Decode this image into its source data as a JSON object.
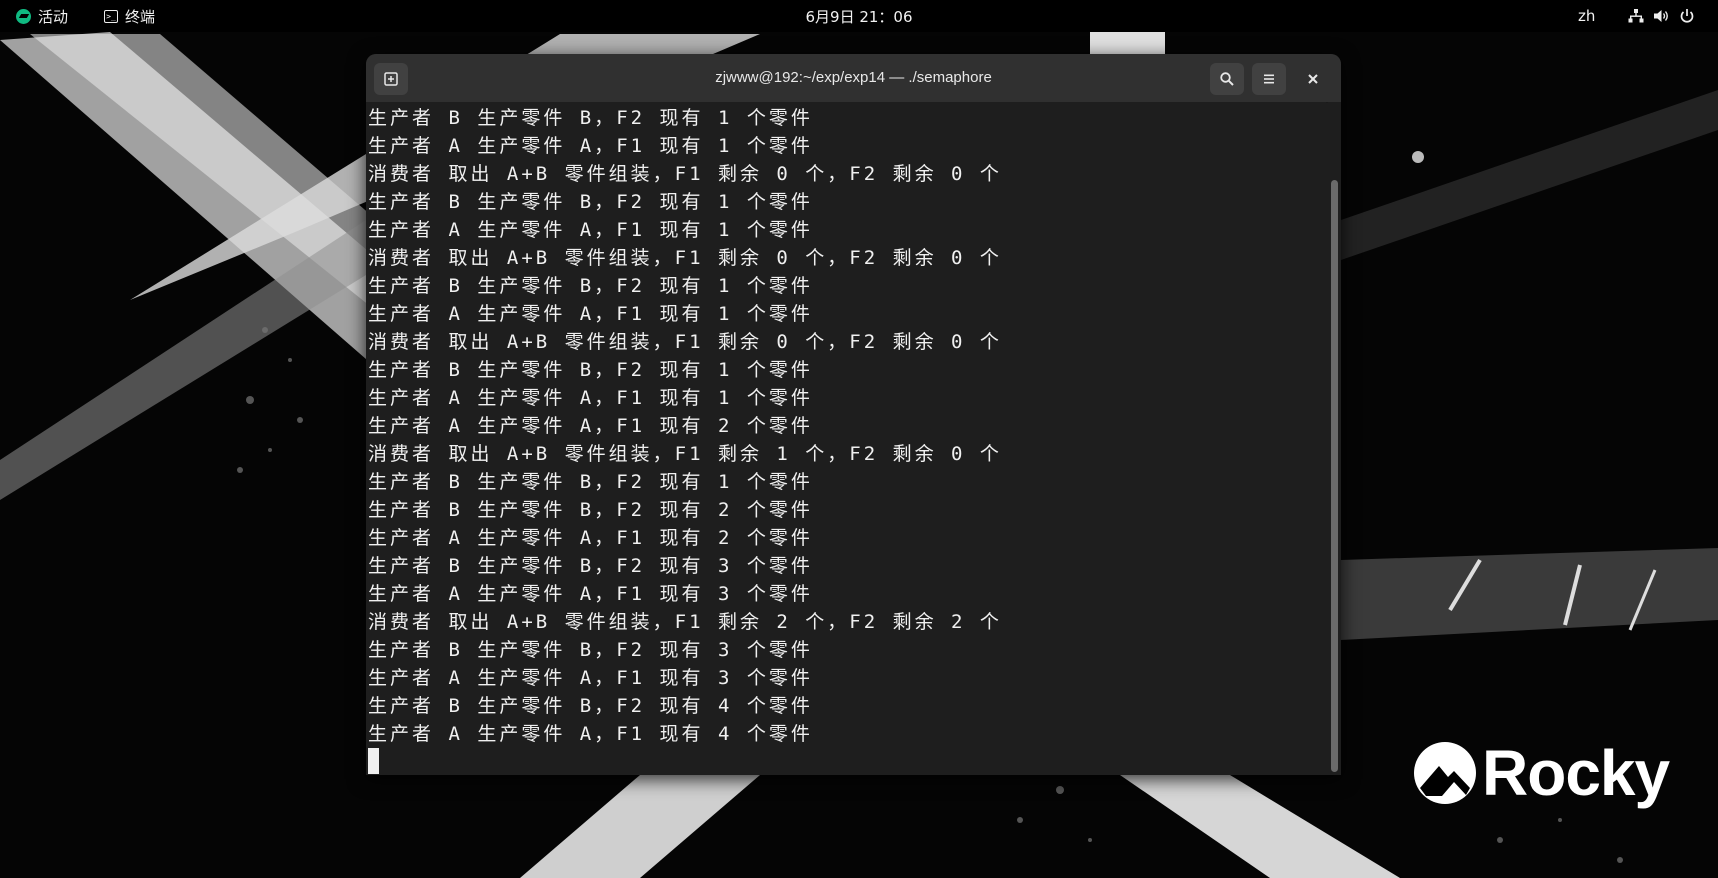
{
  "topbar": {
    "activities": "活动",
    "app_name": "终端",
    "clock": "6月9日 21：06",
    "language": "zh"
  },
  "window": {
    "title": "zjwww@192:~/exp/exp14 — ./semaphore"
  },
  "terminal": {
    "lines": [
      "生产者 B 生产零件 B，F2 现有 1 个零件",
      "生产者 A 生产零件 A，F1 现有 1 个零件",
      "消费者 取出 A+B 零件组装，F1 剩余 0 个，F2 剩余 0 个",
      "生产者 B 生产零件 B，F2 现有 1 个零件",
      "生产者 A 生产零件 A，F1 现有 1 个零件",
      "消费者 取出 A+B 零件组装，F1 剩余 0 个，F2 剩余 0 个",
      "生产者 B 生产零件 B，F2 现有 1 个零件",
      "生产者 A 生产零件 A，F1 现有 1 个零件",
      "消费者 取出 A+B 零件组装，F1 剩余 0 个，F2 剩余 0 个",
      "生产者 B 生产零件 B，F2 现有 1 个零件",
      "生产者 A 生产零件 A，F1 现有 1 个零件",
      "生产者 A 生产零件 A，F1 现有 2 个零件",
      "消费者 取出 A+B 零件组装，F1 剩余 1 个，F2 剩余 0 个",
      "生产者 B 生产零件 B，F2 现有 1 个零件",
      "生产者 B 生产零件 B，F2 现有 2 个零件",
      "生产者 A 生产零件 A，F1 现有 2 个零件",
      "生产者 B 生产零件 B，F2 现有 3 个零件",
      "生产者 A 生产零件 A，F1 现有 3 个零件",
      "消费者 取出 A+B 零件组装，F1 剩余 2 个，F2 剩余 2 个",
      "生产者 B 生产零件 B，F2 现有 3 个零件",
      "生产者 A 生产零件 A，F1 现有 3 个零件",
      "生产者 B 生产零件 B，F2 现有 4 个零件",
      "生产者 A 生产零件 A，F1 现有 4 个零件"
    ]
  },
  "desktop": {
    "logo_text": "Rocky"
  },
  "icons": {
    "activities": "rocky-logo-icon",
    "app": "terminal-icon",
    "new_tab": "new-tab-icon",
    "search": "search-icon",
    "menu": "hamburger-menu-icon",
    "close": "close-icon",
    "network": "network-icon",
    "volume": "volume-icon",
    "power": "power-icon"
  },
  "colors": {
    "accent": "#10b981",
    "terminal_bg": "#1e1e1e",
    "headerbar_bg": "#303030",
    "text": "#f0f0f0"
  }
}
